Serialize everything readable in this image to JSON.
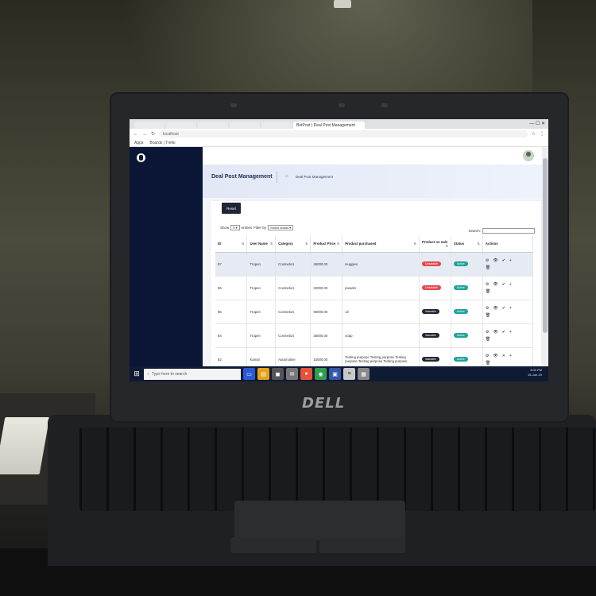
{
  "browser": {
    "tabs": [
      "BetPost | Deal Post Management"
    ],
    "url": "localhost",
    "bookmarks": [
      "Apps",
      "Boards | Trello"
    ]
  },
  "app": {
    "page_title": "Deal Post Management",
    "breadcrumb": "Deal Post Management",
    "reset_label": "Reset",
    "show_label": "Show",
    "entries_value": "5",
    "entries_label": "entries",
    "filter_label": "Filter by",
    "filter_value": "Select status",
    "search_label": "Search:"
  },
  "table": {
    "headers": [
      "ID",
      "User Name",
      "Category",
      "Product Price",
      "Product purchased",
      "Product on sale",
      "Status",
      "Actions"
    ],
    "rows": [
      {
        "id": "87",
        "user": "Trupen",
        "category": "Cosmetics",
        "price": "45000.00",
        "product": "Huggies",
        "on_sale": "Unsalable",
        "on_sale_color": "#e5484d",
        "status": "Active"
      },
      {
        "id": "86",
        "user": "Trupen",
        "category": "Cosmetics",
        "price": "32000.00",
        "product": "powder",
        "on_sale": "Unsalable",
        "on_sale_color": "#e5484d",
        "status": "Active"
      },
      {
        "id": "85",
        "user": "Trupen",
        "category": "Cosmetics",
        "price": "90000.00",
        "product": "oil",
        "on_sale": "Saleable",
        "on_sale_color": "#20262f",
        "status": "Active"
      },
      {
        "id": "84",
        "user": "Trupen",
        "category": "Cosmetics",
        "price": "35000.00",
        "product": "soap",
        "on_sale": "Saleable",
        "on_sale_color": "#20262f",
        "status": "Active"
      },
      {
        "id": "82",
        "user": "Kamal",
        "category": "Automotive",
        "price": "10000.00",
        "product": "Testing purpose Testing purpose Testing purpose Testing purpose Testing purpose",
        "on_sale": "Saleable",
        "on_sale_color": "#20262f",
        "status": "Active"
      }
    ]
  },
  "taskbar": {
    "search_placeholder": "Type here to search",
    "time": "3:00 PM",
    "date": "15-Jun-19"
  },
  "laptop": {
    "brand": "DELL"
  },
  "colors": {
    "sidebar": "#0b1637",
    "accent": "#1ea39a",
    "danger": "#e5484d"
  }
}
